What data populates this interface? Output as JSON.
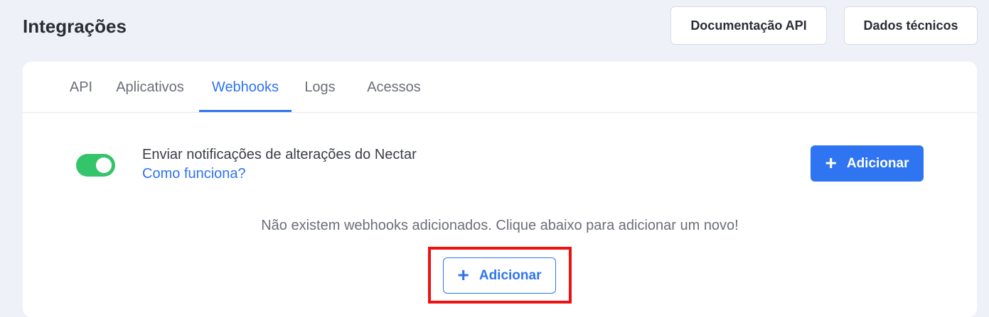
{
  "header": {
    "title": "Integrações",
    "doc_button": "Documentação API",
    "tech_button": "Dados técnicos"
  },
  "tabs": [
    {
      "label": "API"
    },
    {
      "label": "Aplicativos"
    },
    {
      "label": "Webhooks",
      "active": true
    },
    {
      "label": "Logs"
    },
    {
      "label": "Acessos"
    }
  ],
  "webhooks": {
    "toggle_enabled": true,
    "notify_label": "Enviar notificações de alterações do Nectar",
    "how_link": "Como funciona?",
    "add_button": "Adicionar",
    "empty_message": "Não existem webhooks adicionados. Clique abaixo para adicionar um novo!",
    "add_button_secondary": "Adicionar"
  },
  "icons": {
    "plus": "plus-icon"
  },
  "colors": {
    "accent": "#2f74f0",
    "toggle_on": "#34c46a",
    "highlight": "#ee1111",
    "background": "#eef1f8"
  }
}
